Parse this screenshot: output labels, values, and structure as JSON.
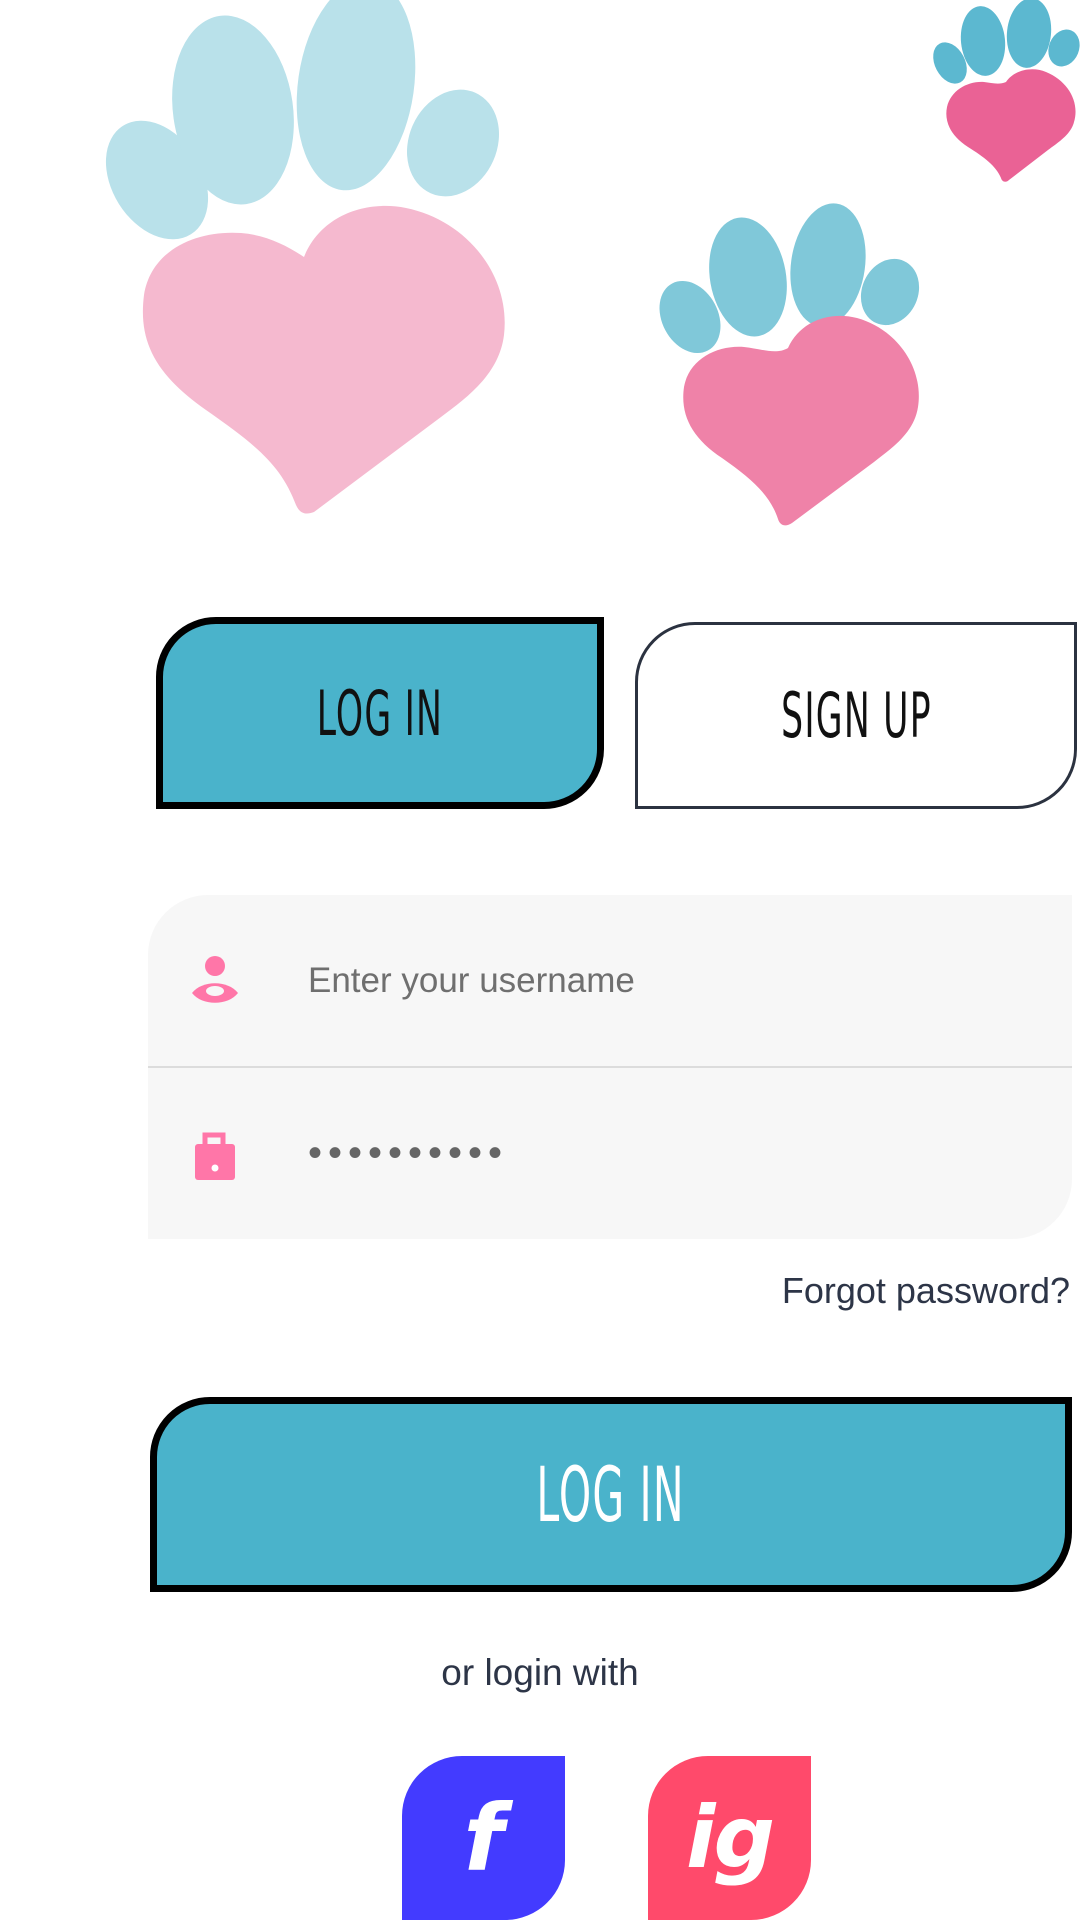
{
  "colors": {
    "accent": "#4ab3cb",
    "paw_light_blue": "#b9e1ea",
    "paw_mid_blue": "#80c8d9",
    "paw_dark_blue": "#5cb8d0",
    "heart_light_pink": "#f5b9cf",
    "heart_mid_pink": "#ef82a8",
    "heart_dark_pink": "#ea6295",
    "icon_pink": "#ff76a8",
    "facebook": "#433bff",
    "instagram": "#ff4a6b"
  },
  "tabs": {
    "login_label": "LOG IN",
    "signup_label": "SIGN UP",
    "active": "login"
  },
  "form": {
    "username_placeholder": "Enter your username",
    "username_icon": "user-icon",
    "password_value": "••••••••••",
    "password_icon": "lock-icon"
  },
  "forgot_password": "Forgot password?",
  "login_button": "LOG IN",
  "alt_login_text": "or login with",
  "social": {
    "facebook_label": "f",
    "instagram_label": "ig"
  }
}
